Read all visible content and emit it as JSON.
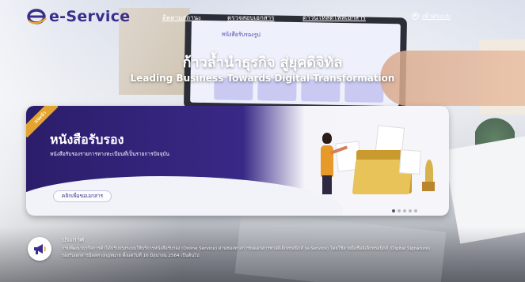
{
  "header": {
    "logo_text": "e-Service",
    "nav": [
      {
        "label": "ติดตามสถานะ"
      },
      {
        "label": "ตรวจสอบเอกสาร"
      },
      {
        "label": "ดาวน์โหลดไฟล์เอกสาร"
      }
    ],
    "login_label": "เข้าสู่ระบบ"
  },
  "hero": {
    "title_th": "ก้าวล้ำนำธุรกิจ สู่ยุคดิจิทัล",
    "title_en": "Leading Business Towards Digital Transformation"
  },
  "banner": {
    "badge": "แนะนำ",
    "title": "หนังสือรับรอง",
    "subtitle": "หนังสือรับรองรายการทางทะเบียนที่เป็นรายการปัจจุบัน",
    "button_label": "คลิกเพื่อขอเอกสาร",
    "screen_title": "หนังสือรับรองรูป",
    "slides": [
      true,
      false,
      false,
      false,
      false
    ]
  },
  "announcement": {
    "title": "ประกาศ",
    "text": "กรมพัฒนาธุรกิจการค้าได้ปรับปรุงระบบให้บริการหนังสือรับรอง (Online Service) ผ่านช่องทางการขอเอกสารทางอิเล็กทรอนิกส์ (e-Service) โดยใช้ลายมือชื่ออิเล็กทรอนิกส์ (Digital Signature) รองรับเอกสารมีผลทางกฎหมาย ตั้งแต่วันที่ 16 มิถุนายน 2564 เป็นต้นไป"
  },
  "colors": {
    "brand": "#3a2d8c",
    "banner_dark": "#2c1d6b",
    "badge": "#e4a530"
  },
  "icons": {
    "login": "user-icon",
    "announcement": "megaphone-icon"
  }
}
